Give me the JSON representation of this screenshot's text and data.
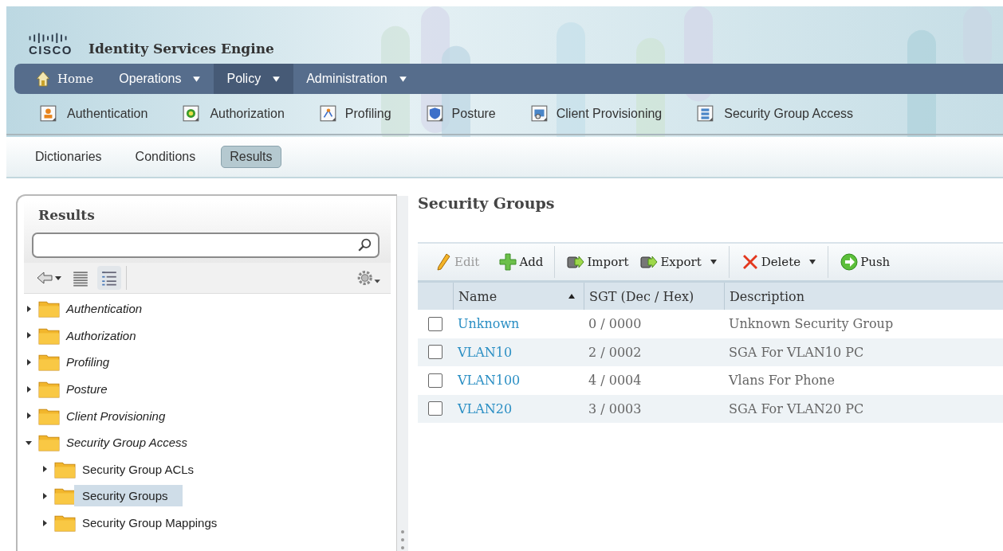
{
  "header": {
    "logo": "CISCO",
    "product": "Identity Services Engine"
  },
  "nav": [
    {
      "label": "Home",
      "kind": "home",
      "dropdown": false,
      "selected": false
    },
    {
      "label": "Operations",
      "kind": "menu",
      "dropdown": true,
      "selected": false
    },
    {
      "label": "Policy",
      "kind": "menu",
      "dropdown": true,
      "selected": true
    },
    {
      "label": "Administration",
      "kind": "menu",
      "dropdown": true,
      "selected": false
    }
  ],
  "subnav": [
    {
      "label": "Authentication",
      "kind": "person"
    },
    {
      "label": "Authorization",
      "kind": "check"
    },
    {
      "label": "Profiling",
      "kind": "nodes"
    },
    {
      "label": "Posture",
      "kind": "shield"
    },
    {
      "label": "Client Provisioning",
      "kind": "monitor"
    },
    {
      "label": "Security Group Access",
      "kind": "stack"
    }
  ],
  "tabs": [
    {
      "label": "Dictionaries",
      "selected": false
    },
    {
      "label": "Conditions",
      "selected": false
    },
    {
      "label": "Results",
      "selected": true
    }
  ],
  "sidebar": {
    "title": "Results",
    "views": [
      {
        "kind": "list",
        "selected": false
      },
      {
        "kind": "tree",
        "selected": true
      }
    ],
    "items": [
      {
        "label": "Authentication",
        "expanded": false,
        "selected": false
      },
      {
        "label": "Authorization",
        "expanded": false,
        "selected": false
      },
      {
        "label": "Profiling",
        "expanded": false,
        "selected": false
      },
      {
        "label": "Posture",
        "expanded": false,
        "selected": false
      },
      {
        "label": "Client Provisioning",
        "expanded": false,
        "selected": false
      },
      {
        "label": "Security Group Access",
        "expanded": true,
        "selected": false,
        "children": [
          {
            "label": "Security Group ACLs",
            "expanded": false,
            "selected": false
          },
          {
            "label": "Security Groups",
            "expanded": false,
            "selected": true
          },
          {
            "label": "Security Group Mappings",
            "expanded": false,
            "selected": false
          }
        ]
      }
    ]
  },
  "content": {
    "title": "Security Groups",
    "toolbar": [
      [
        {
          "label": "Edit",
          "kind": "edit",
          "disabled": true,
          "dropdown": false
        },
        {
          "label": "Add",
          "kind": "add",
          "disabled": false,
          "dropdown": false
        }
      ],
      [
        {
          "label": "Import",
          "kind": "import",
          "disabled": false,
          "dropdown": false
        },
        {
          "label": "Export",
          "kind": "export",
          "disabled": false,
          "dropdown": true
        }
      ],
      [
        {
          "label": "Delete",
          "kind": "delete",
          "disabled": false,
          "dropdown": true
        }
      ],
      [
        {
          "label": "Push",
          "kind": "push",
          "disabled": false,
          "dropdown": false
        }
      ]
    ],
    "table": {
      "columns": [
        {
          "label": "Name",
          "sorted": true
        },
        {
          "label": "SGT (Dec / Hex)",
          "sorted": false
        },
        {
          "label": "Description",
          "sorted": false
        }
      ],
      "rows": [
        {
          "checked": false,
          "cells": [
            "Unknown",
            "0 / 0000",
            "Unknown Security Group"
          ]
        },
        {
          "checked": false,
          "cells": [
            "VLAN10",
            "2 / 0002",
            "SGA For VLAN10 PC"
          ]
        },
        {
          "checked": false,
          "cells": [
            "VLAN100",
            "4 / 0004",
            "Vlans For Phone"
          ]
        },
        {
          "checked": false,
          "cells": [
            "VLAN20",
            "3 / 0003",
            "SGA For VLAN20 PC"
          ]
        }
      ]
    }
  }
}
